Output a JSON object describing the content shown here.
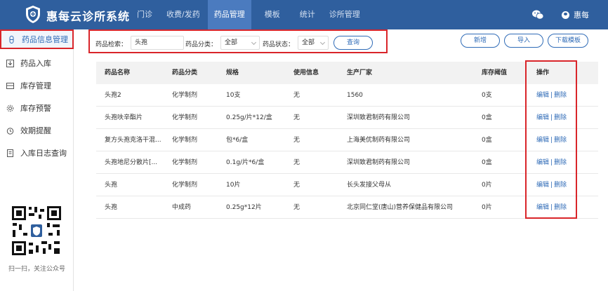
{
  "app": {
    "title": "惠每云诊所系统",
    "user": "惠每"
  },
  "nav": [
    {
      "label": "门诊",
      "active": false
    },
    {
      "label": "收费/发药",
      "active": false
    },
    {
      "label": "药品管理",
      "active": true
    },
    {
      "label": "模板",
      "active": false
    },
    {
      "label": "统计",
      "active": false
    },
    {
      "label": "诊所管理",
      "active": false
    }
  ],
  "sidebar": {
    "items": [
      {
        "label": "药品信息管理",
        "icon": "pill-icon",
        "active": true
      },
      {
        "label": "药品入库",
        "icon": "inbox-icon",
        "active": false
      },
      {
        "label": "库存管理",
        "icon": "box-icon",
        "active": false
      },
      {
        "label": "库存预警",
        "icon": "gear-icon",
        "active": false
      },
      {
        "label": "效期提醒",
        "icon": "alarm-icon",
        "active": false
      },
      {
        "label": "入库日志查询",
        "icon": "document-icon",
        "active": false
      }
    ],
    "qr_caption": "扫一扫，关注公众号"
  },
  "search": {
    "drug_label": "药品检索：",
    "drug_value": "头孢",
    "category_label": "药品分类：",
    "category_value": "全部",
    "status_label": "药品状态：",
    "status_value": "全部",
    "query_button": "查询"
  },
  "actions": {
    "add": "新增",
    "import": "导入",
    "download": "下载模板"
  },
  "table": {
    "headers": [
      "药品名称",
      "药品分类",
      "规格",
      "使用信息",
      "生产厂家",
      "库存阈值",
      "操作"
    ],
    "edit_label": "编辑",
    "delete_label": "删除",
    "rows": [
      [
        "头孢2",
        "化学制剂",
        "10支",
        "无",
        "1560",
        "0支"
      ],
      [
        "头孢呋辛酯片",
        "化学制剂",
        "0.25g/片*12/盒",
        "无",
        "深圳致君制药有限公司",
        "0盒"
      ],
      [
        "复方头孢克洛干混...",
        "化学制剂",
        "包*6/盒",
        "无",
        "上海美优制药有限公司",
        "0盒"
      ],
      [
        "头孢地尼分散片[...",
        "化学制剂",
        "0.1g/片*6/盒",
        "无",
        "深圳致君制药有限公司",
        "0盒"
      ],
      [
        "头孢",
        "化学制剂",
        "10片",
        "无",
        "长头发接父母从",
        "0片"
      ],
      [
        "头孢",
        "中成药",
        "0.25g*12片",
        "无",
        "北京同仁堂(唐山)营养保健品有限公司",
        "0片"
      ]
    ]
  }
}
